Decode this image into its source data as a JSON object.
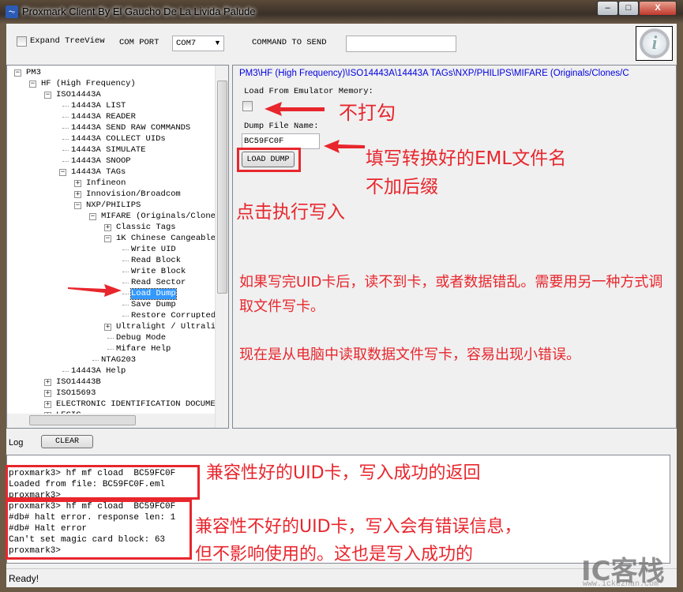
{
  "window": {
    "title": "Proxmark Client By El Gaucho De La Livida Palude",
    "minimize": "‒",
    "maximize": "□",
    "close": "X"
  },
  "toolbar": {
    "expand_treeview": "Expand TreeView",
    "expand_checked": false,
    "com_port_label": "COM PORT",
    "com_port_value": "COM7",
    "command_label": "COMMAND TO SEND",
    "command_value": "",
    "info_icon": "info-icon"
  },
  "tree": {
    "items": [
      {
        "label": "PM3",
        "level": 0,
        "toggle": "-"
      },
      {
        "label": "HF (High Frequency)",
        "level": 1,
        "toggle": "-"
      },
      {
        "label": "ISO14443A",
        "level": 2,
        "toggle": "-"
      },
      {
        "label": "14443A LIST",
        "level": 3
      },
      {
        "label": "14443A READER",
        "level": 3
      },
      {
        "label": "14443A SEND RAW COMMANDS",
        "level": 3
      },
      {
        "label": "14443A COLLECT UIDs",
        "level": 3
      },
      {
        "label": "14443A SIMULATE",
        "level": 3
      },
      {
        "label": "14443A SNOOP",
        "level": 3
      },
      {
        "label": "14443A TAGs",
        "level": 3,
        "toggle": "-"
      },
      {
        "label": "Infineon",
        "level": 4,
        "toggle": "+"
      },
      {
        "label": "Innovision/Broadcom",
        "level": 4,
        "toggle": "+"
      },
      {
        "label": "NXP/PHILIPS",
        "level": 4,
        "toggle": "-"
      },
      {
        "label": "MIFARE (Originals/Clones",
        "level": 5,
        "toggle": "-"
      },
      {
        "label": "Classic Tags",
        "level": 6,
        "toggle": "+"
      },
      {
        "label": "1K Chinese Cangeable",
        "level": 6,
        "toggle": "-"
      },
      {
        "label": "Write UID",
        "level": 7
      },
      {
        "label": "Read Block",
        "level": 7
      },
      {
        "label": "Write Block",
        "level": 7
      },
      {
        "label": "Read Sector",
        "level": 7
      },
      {
        "label": "Load Dump",
        "level": 7,
        "selected": true
      },
      {
        "label": "Save Dump",
        "level": 7
      },
      {
        "label": "Restore Corrupted",
        "level": 7
      },
      {
        "label": "Ultralight / Ultrali",
        "level": 6,
        "toggle": "+"
      },
      {
        "label": "Debug Mode",
        "level": 6
      },
      {
        "label": "Mifare Help",
        "level": 6
      },
      {
        "label": "NTAG203",
        "level": 5
      },
      {
        "label": "14443A Help",
        "level": 3
      },
      {
        "label": "ISO14443B",
        "level": 2,
        "toggle": "+"
      },
      {
        "label": "ISO15693",
        "level": 2,
        "toggle": "+"
      },
      {
        "label": "ELECTRONIC IDENTIFICATION DOCUMEN",
        "level": 2,
        "toggle": "+"
      },
      {
        "label": "LEGIC",
        "level": 2,
        "toggle": "+"
      }
    ]
  },
  "panel": {
    "breadcrumb": "PM3\\HF (High Frequency)\\ISO14443A\\14443A TAGs\\NXP/PHILIPS\\MIFARE (Originals/Clones/C",
    "load_emulator_label": "Load From Emulator Memory:",
    "load_emulator_checked": false,
    "dump_file_label": "Dump File Name:",
    "dump_file_value": "BC59FC0F",
    "load_dump_button": "LOAD DUMP"
  },
  "annotations": {
    "no_check": "不打勾",
    "fill_name_1": "填写转换好的EML文件名",
    "fill_name_2": "不加后缀",
    "click_write": "点击执行写入",
    "note1": "如果写完UID卡后，读不到卡，或者数据错乱。需要用另一种方式调取文件写卡。",
    "note2": "现在是从电脑中读取数据文件写卡，容易出现小错误。",
    "good_uid": "兼容性好的UID卡，写入成功的返回",
    "bad_uid_1": "兼容性不好的UID卡，写入会有错误信息，",
    "bad_uid_2": "但不影响使用的。这也是写入成功的",
    "accent": "#e8262d"
  },
  "log": {
    "label": "Log",
    "clear_button": "CLEAR",
    "lines": [
      "proxmark3> hf mf cload  BC59FC0F",
      "Loaded from file: BC59FC0F.eml",
      "proxmark3>",
      "proxmark3> hf mf cload  BC59FC0F",
      "#db# halt error. response len: 1",
      "#db# Halt error",
      "Can't set magic card block: 63",
      "proxmark3>"
    ]
  },
  "status": {
    "text": "Ready!"
  },
  "watermark": {
    "logo": "IC客栈",
    "url": "www.ickezhan.com"
  }
}
